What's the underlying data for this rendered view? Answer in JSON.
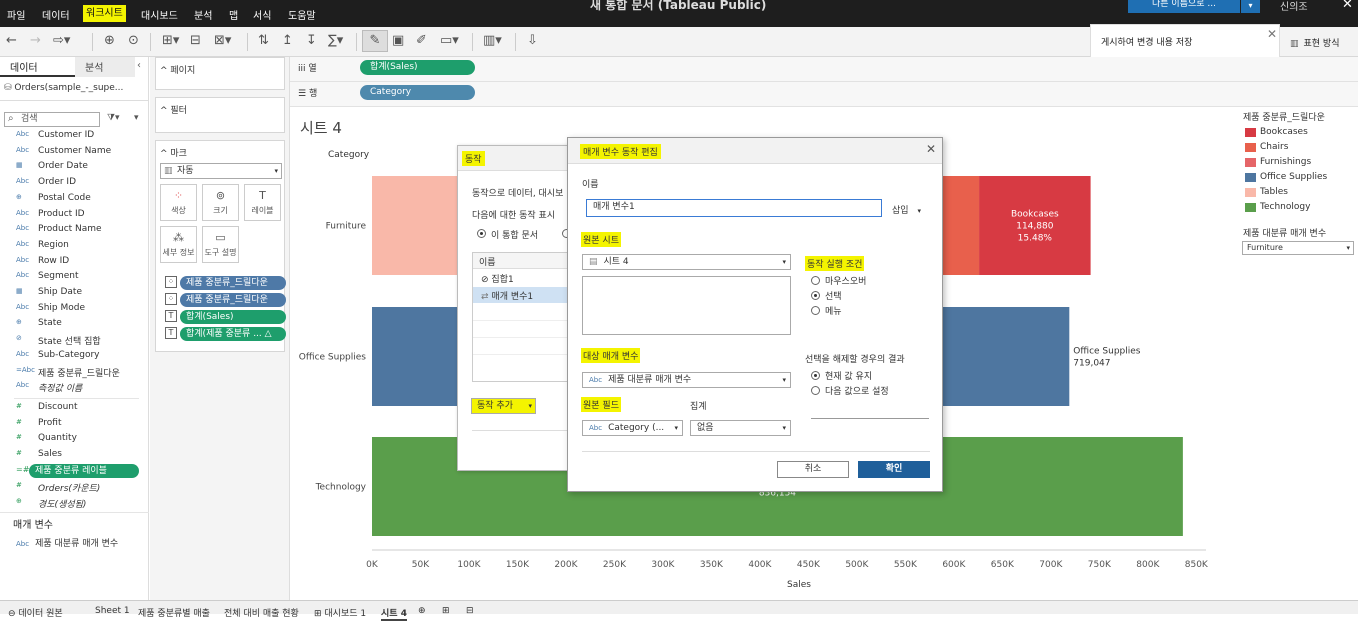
{
  "app": {
    "title": "새 통합 문서 (Tableau Public)",
    "menu": [
      "파일",
      "데이터",
      "워크시트",
      "대시보드",
      "분석",
      "맵",
      "서식",
      "도움말"
    ],
    "save_button": "다른 이름으로 ...",
    "user": "신의조"
  },
  "notification": "게시하여 변경 내용 저장",
  "show_me": "표현 방식",
  "left_panel": {
    "tab_data": "데이터",
    "tab_analysis": "분석",
    "collapse": "‹",
    "datasource": "Orders(sample_-_supe...",
    "search_placeholder": "검색",
    "dimensions": [
      {
        "type": "Abc",
        "name": "Customer ID"
      },
      {
        "type": "Abc",
        "name": "Customer Name"
      },
      {
        "type": "▦",
        "name": "Order Date"
      },
      {
        "type": "Abc",
        "name": "Order ID"
      },
      {
        "type": "⊕",
        "name": "Postal Code"
      },
      {
        "type": "Abc",
        "name": "Product ID"
      },
      {
        "type": "Abc",
        "name": "Product Name"
      },
      {
        "type": "Abc",
        "name": "Region"
      },
      {
        "type": "Abc",
        "name": "Row ID"
      },
      {
        "type": "Abc",
        "name": "Segment"
      },
      {
        "type": "▦",
        "name": "Ship Date"
      },
      {
        "type": "Abc",
        "name": "Ship Mode"
      },
      {
        "type": "⊕",
        "name": "State"
      },
      {
        "type": "⊘",
        "name": "State 선택 집합"
      },
      {
        "type": "Abc",
        "name": "Sub-Category"
      },
      {
        "type": "=Abc",
        "name": "제품 중분류_드릴다운"
      },
      {
        "type": "Abc",
        "name": "측정값 이름"
      }
    ],
    "measures": [
      {
        "type": "#",
        "name": "Discount"
      },
      {
        "type": "#",
        "name": "Profit"
      },
      {
        "type": "#",
        "name": "Quantity"
      },
      {
        "type": "#",
        "name": "Sales"
      }
    ],
    "measure_selected": "제품 중분류 레이블",
    "measures_extra": [
      {
        "type": "#",
        "name": "Orders(카운트)"
      },
      {
        "type": "⊕",
        "name": "경도(생성됨)"
      }
    ],
    "params_title": "매개 변수",
    "param": {
      "type": "Abc",
      "name": "제품 대분류 매개 변수"
    }
  },
  "cards": {
    "pages": "페이지",
    "filters": "필터",
    "marks": "마크",
    "marks_type": "자동",
    "mark_buttons": [
      "색상",
      "크기",
      "레이블",
      "세부 정보",
      "도구 설명"
    ],
    "mark_pills": [
      {
        "icon": "⁘",
        "label": "제품 중분류_드릴다운",
        "color": "#4e79a7"
      },
      {
        "icon": "⁘",
        "label": "제품 중분류_드릴다운",
        "color": "#4e79a7"
      },
      {
        "icon": "T",
        "label": "합계(Sales)",
        "color": "#1e9e6c"
      },
      {
        "icon": "T",
        "label": "합계(제품 중분류 ... △",
        "color": "#1e9e6c"
      }
    ]
  },
  "shelves": {
    "columns_label": "열",
    "columns_pill": "합계(Sales)",
    "rows_label": "행",
    "rows_pill": "Category"
  },
  "sheet": {
    "title": "시트 4"
  },
  "chart_data": {
    "type": "bar",
    "orientation": "horizontal-stacked",
    "row_header": "Category",
    "categories": [
      "Furniture",
      "Office Supplies",
      "Technology"
    ],
    "x_label": "Sales",
    "x_ticks": [
      "0K",
      "50K",
      "100K",
      "150K",
      "200K",
      "250K",
      "300K",
      "350K",
      "400K",
      "450K",
      "500K",
      "550K",
      "600K",
      "650K",
      "700K",
      "750K",
      "800K",
      "850K"
    ],
    "xlim": [
      0,
      860000
    ],
    "segments": [
      {
        "category": "Furniture",
        "subcategory": "Tables",
        "start": 0,
        "end": 450000,
        "color": "#f9b8a9"
      },
      {
        "category": "Furniture",
        "subcategory": "Chairs",
        "start": 450000,
        "end": 626000,
        "color": "#e8604c"
      },
      {
        "category": "Furniture",
        "subcategory": "Bookcases",
        "start": 626000,
        "end": 741000,
        "color": "#d73a43",
        "label": [
          "Bookcases",
          "114,880",
          "15.48%"
        ]
      },
      {
        "category": "Office Supplies",
        "subcategory": "Office Supplies",
        "start": 0,
        "end": 719047,
        "color": "#4e76a0",
        "label_outside": [
          "Office Supplies",
          "719,047"
        ]
      },
      {
        "category": "Technology",
        "subcategory": "Technology",
        "start": 0,
        "end": 836154,
        "color": "#5a9e4b",
        "label": [
          "Technology",
          "836,154"
        ]
      }
    ]
  },
  "legend": {
    "title": "제품 중분류_드릴다운",
    "items": [
      {
        "name": "Bookcases",
        "color": "#d73a43"
      },
      {
        "name": "Chairs",
        "color": "#e8604c"
      },
      {
        "name": "Furnishings",
        "color": "#e56568"
      },
      {
        "name": "Office Supplies",
        "color": "#4e76a0"
      },
      {
        "name": "Tables",
        "color": "#f9b8a9"
      },
      {
        "name": "Technology",
        "color": "#5a9e4b"
      }
    ]
  },
  "param_card": {
    "title": "제품 대분류 매개 변수",
    "value": "Furniture"
  },
  "actions_dialog": {
    "title": "동작",
    "desc": "동작으로 데이터, 대시보",
    "show_for": "다음에 대한 동작 표시",
    "radio_label": "이 통합 문서",
    "col_name": "이름",
    "rows": [
      "집합1",
      "매개 변수1"
    ],
    "add_button": "동작 추가"
  },
  "edit_dialog": {
    "title": "매개 변수 동작 편집",
    "name_label": "이름",
    "name_value": "매개 변수1",
    "insert": "삽입",
    "source_sheets_label": "원본 시트",
    "source_sheet": "시트 4",
    "run_on_label": "동작 실행 조건",
    "run_on": [
      "마우스오버",
      "선택",
      "메뉴"
    ],
    "target_param_label": "대상 매개 변수",
    "target_param": "제품 대분류 매개 변수",
    "clear_label": "선택을 해제할 경우의 결과",
    "clear_options": [
      "현재 값 유지",
      "다음 값으로 설정"
    ],
    "source_field_label": "원본 필드",
    "source_field": "Category (...",
    "aggregation_label": "집계",
    "aggregation": "없음",
    "cancel": "취소",
    "ok": "확인"
  },
  "bottom_tabs": [
    "데이터 원본",
    "Sheet 1",
    "제품 중분류별 매출",
    "전체 대비 매출 현황",
    "대시보드 1",
    "시트 4"
  ]
}
